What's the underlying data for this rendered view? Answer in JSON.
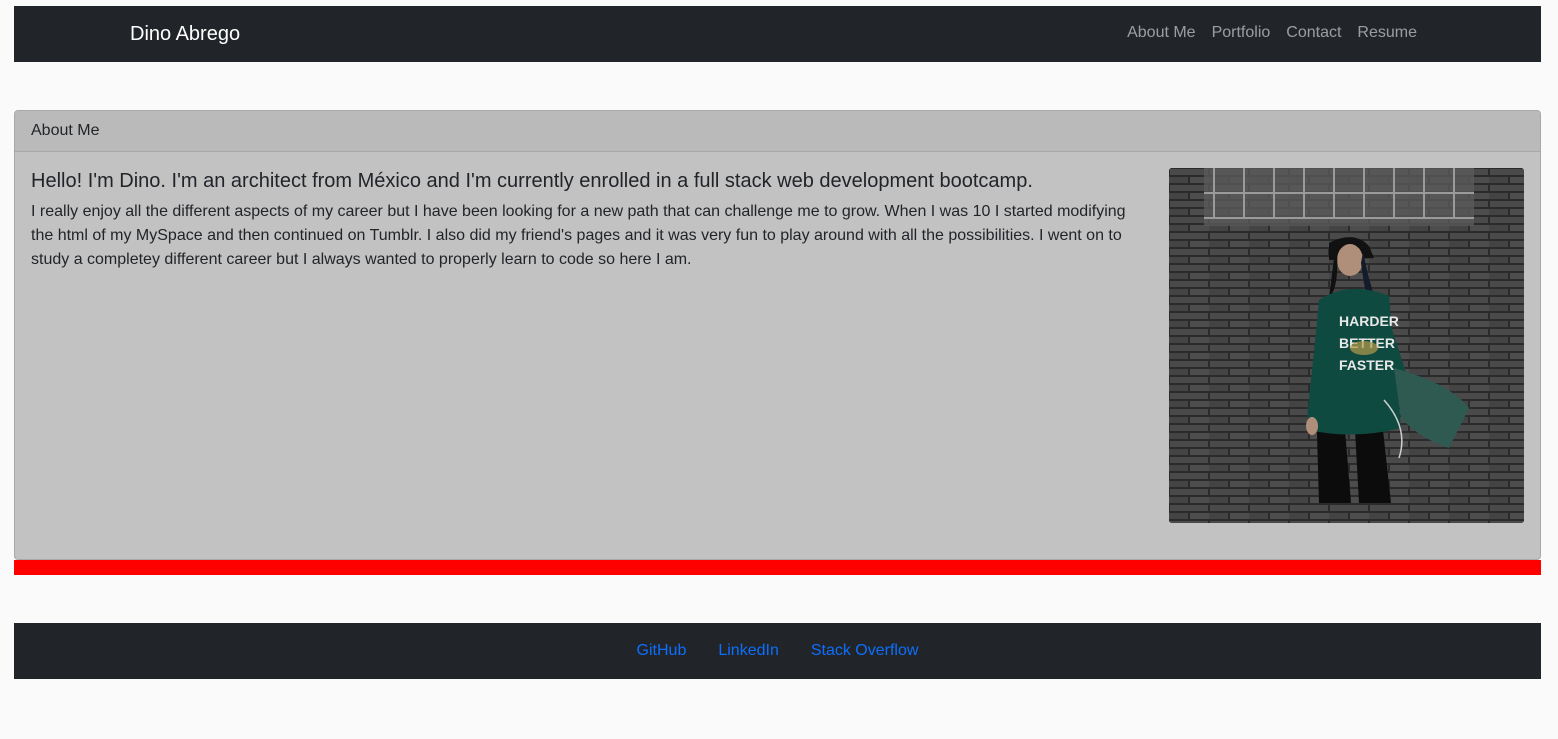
{
  "navbar": {
    "brand": "Dino Abrego",
    "links": [
      "About Me",
      "Portfolio",
      "Contact",
      "Resume"
    ]
  },
  "about": {
    "header": "About Me",
    "lead": "Hello! I'm Dino. I'm an architect from México and I'm currently enrolled in a full stack web development bootcamp.",
    "paragraph": "I really enjoy all the different aspects of my career but I have been looking for a new path that can challenge me to grow. When I was 10 I started modifying the html of my MySpace and then continued on Tumblr. I also did my friend's pages and it was very fun to play around with all the possibilities. I went on to study a completey different career but I always wanted to properly learn to code so here I am.",
    "photo_shirt_text": [
      "HARDER",
      "BETTER",
      "FASTER"
    ]
  },
  "footer": {
    "links": [
      "GitHub",
      "LinkedIn",
      "Stack Overflow"
    ]
  },
  "colors": {
    "navbar_bg": "#212529",
    "card_bg": "#c2c2c2",
    "accent_bar": "#ff0000",
    "link": "#0d6efd"
  }
}
